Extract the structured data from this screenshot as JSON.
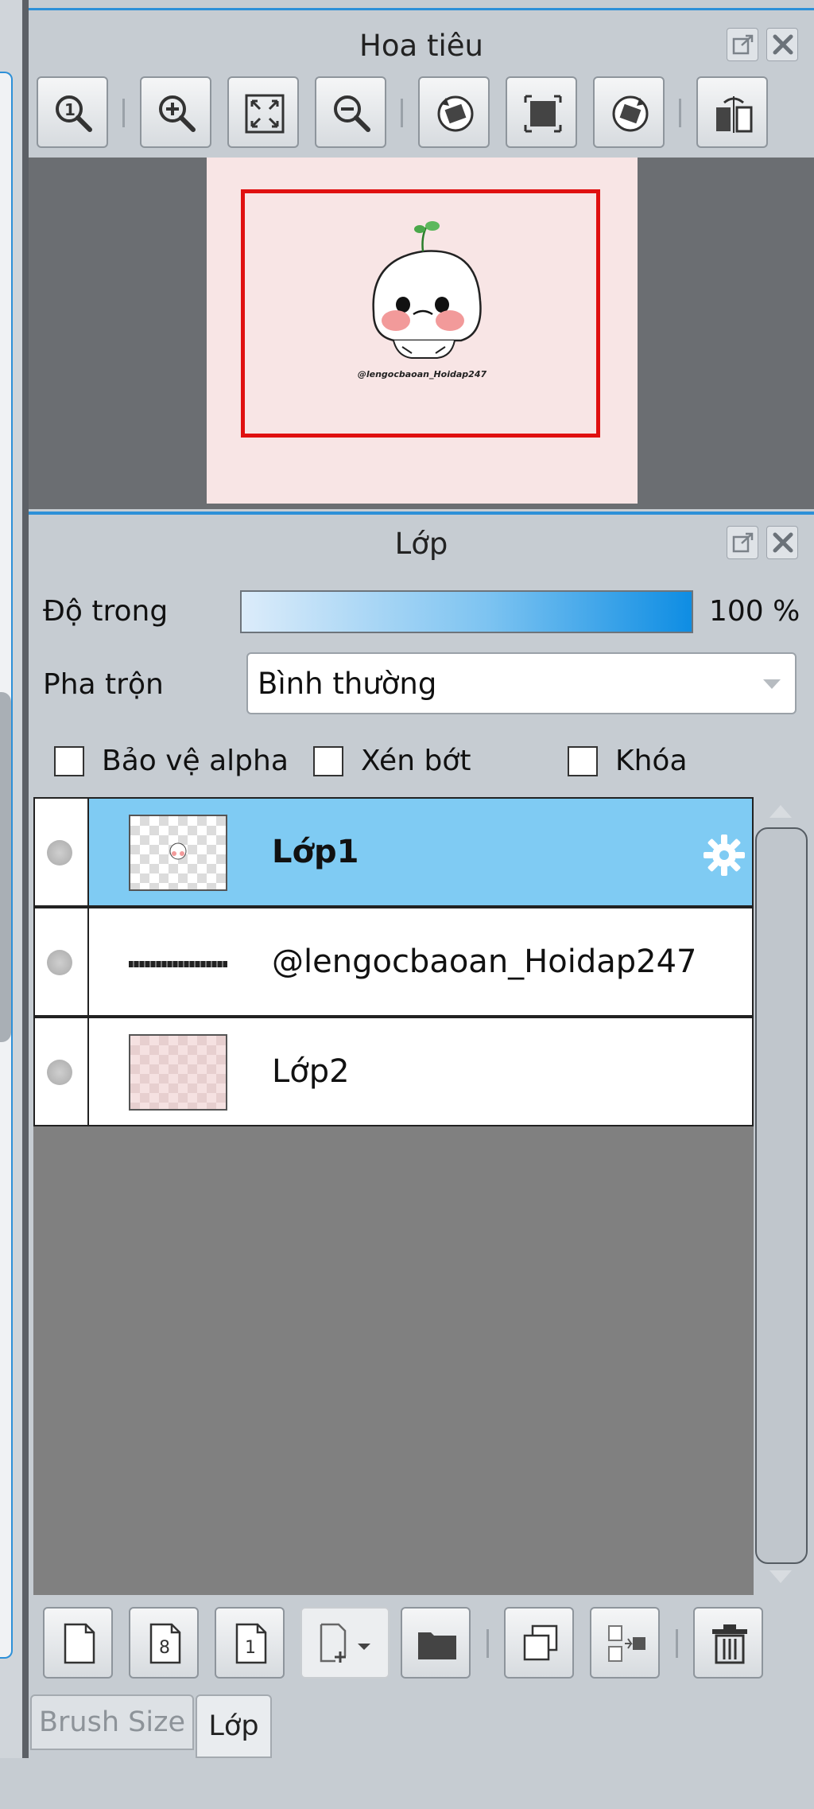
{
  "navigator": {
    "title": "Hoa tiêu",
    "toolbar_icons": [
      "zoom-actual-icon",
      "zoom-in-icon",
      "zoom-fit-icon",
      "zoom-out-icon",
      "rotate-left-icon",
      "fit-window-icon",
      "rotate-right-icon",
      "flip-horizontal-icon"
    ],
    "frame_color": "#e01010",
    "canvas_color": "#f8e5e5",
    "preview_caption": "@lengocbaoan_Hoidap247"
  },
  "layer_panel": {
    "title": "Lớp",
    "opacity_label": "Độ trong",
    "opacity_value": "100 %",
    "blend_label": "Pha trộn",
    "blend_value": "Bình thường",
    "checkboxes": {
      "alpha_label": "Bảo vệ alpha",
      "clip_label": "Xén bớt",
      "lock_label": "Khóa"
    },
    "layers": [
      {
        "name": "Lớp1",
        "selected": true
      },
      {
        "name": "@lengocbaoan_Hoidap247",
        "selected": false
      },
      {
        "name": "Lớp2",
        "selected": false
      }
    ],
    "accent_color": "#7fcbf3"
  },
  "bottom_toolbar_icons": [
    "new-layer-icon",
    "new-8bit-layer-icon",
    "new-1bit-layer-icon",
    "add-layer-dropdown-icon",
    "folder-icon",
    "duplicate-layer-icon",
    "merge-down-icon",
    "delete-layer-icon"
  ],
  "tabs": {
    "brush_size": "Brush Size",
    "layer": "Lớp"
  }
}
